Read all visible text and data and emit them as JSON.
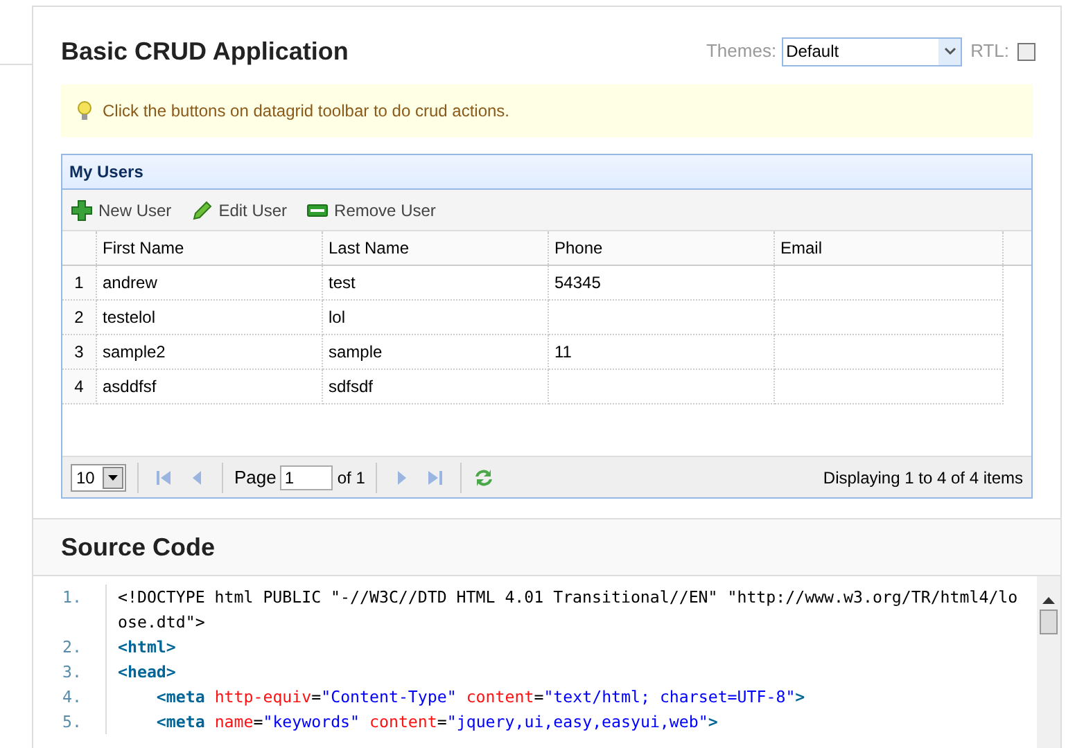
{
  "title": "Basic CRUD Application",
  "themes": {
    "label": "Themes:",
    "value": "Default"
  },
  "rtl": {
    "label": "RTL:",
    "checked": false
  },
  "tip": "Click the buttons on datagrid toolbar to do crud actions.",
  "grid": {
    "title": "My Users",
    "toolbar": [
      {
        "kind": "add",
        "label": "New User"
      },
      {
        "kind": "edit",
        "label": "Edit User"
      },
      {
        "kind": "remove",
        "label": "Remove User"
      }
    ],
    "columns": [
      "First Name",
      "Last Name",
      "Phone",
      "Email"
    ],
    "rows": [
      {
        "number": "1",
        "cells": [
          "andrew",
          "test",
          "54345",
          ""
        ]
      },
      {
        "number": "2",
        "cells": [
          "testelol",
          "lol",
          "",
          ""
        ]
      },
      {
        "number": "3",
        "cells": [
          "sample2",
          "sample",
          "11",
          ""
        ]
      },
      {
        "number": "4",
        "cells": [
          "asddfsf",
          "sdfsdf",
          "",
          ""
        ]
      }
    ],
    "pager": {
      "page_size": "10",
      "page_label": "Page",
      "page": "1",
      "of": "of 1",
      "info": "Displaying 1 to 4 of 4 items"
    }
  },
  "source": {
    "title": "Source Code",
    "lines": [
      {
        "number": "1.",
        "tokens": [
          {
            "kind": "text",
            "text": "<!DOCTYPE html PUBLIC \"-//W3C//DTD HTML 4.01 Transitional//EN\" \"http://www.w3.org/TR/html4/loose.dtd\">"
          }
        ]
      },
      {
        "number": "2.",
        "tokens": [
          {
            "kind": "tag",
            "text": "<html>"
          }
        ]
      },
      {
        "number": "3.",
        "tokens": [
          {
            "kind": "tag",
            "text": "<head>"
          }
        ]
      },
      {
        "number": "4.",
        "tokens": [
          {
            "kind": "tag",
            "text": "<meta"
          },
          {
            "kind": "attr",
            "text": "http-equiv"
          },
          {
            "kind": "text",
            "text": "="
          },
          {
            "kind": "value",
            "text": "\"Content-Type\""
          },
          {
            "kind": "attr",
            "text": "content"
          },
          {
            "kind": "text",
            "text": "="
          },
          {
            "kind": "value",
            "text": "\"text/html; charset=UTF-8\""
          },
          {
            "kind": "tag",
            "text": ">"
          }
        ]
      },
      {
        "number": "5.",
        "tokens": [
          {
            "kind": "tag",
            "text": "<meta"
          },
          {
            "kind": "attr",
            "text": "name"
          },
          {
            "kind": "text",
            "text": "="
          },
          {
            "kind": "value",
            "text": "\"keywords\""
          },
          {
            "kind": "attr",
            "text": "content"
          },
          {
            "kind": "text",
            "text": "="
          },
          {
            "kind": "value",
            "text": "\"jquery,ui,easy,easyui,web\""
          },
          {
            "kind": "tag",
            "text": ">"
          }
        ]
      }
    ]
  }
}
